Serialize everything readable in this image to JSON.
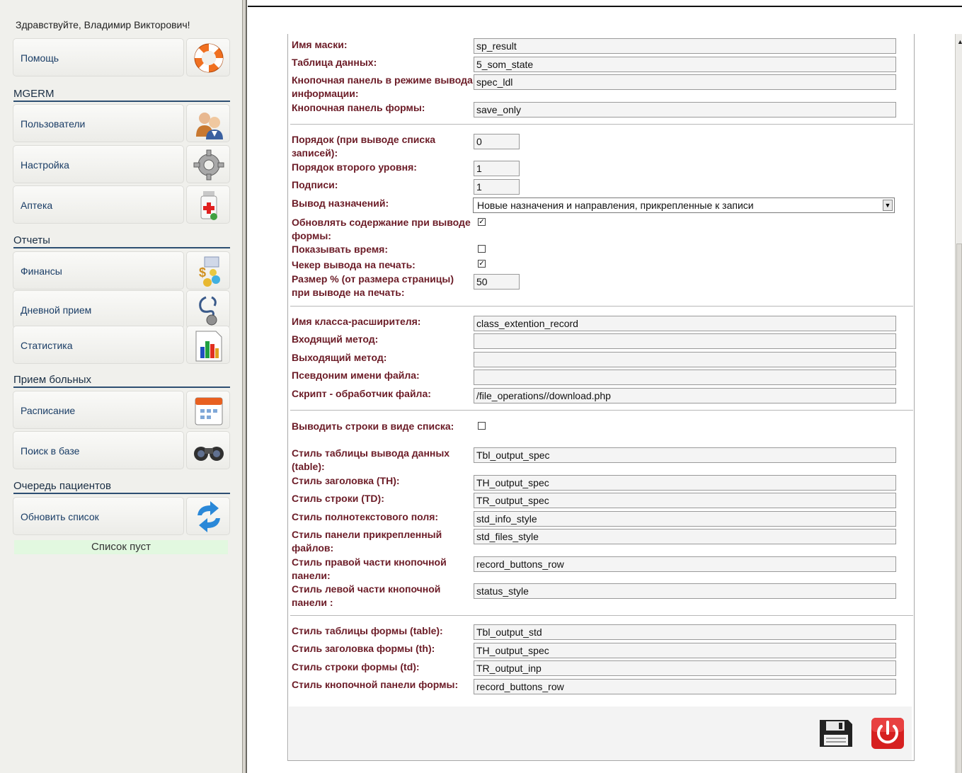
{
  "sidebar": {
    "greeting": "Здравствуйте, Владимир Викторович!",
    "help_label": "Помощь",
    "sections": [
      {
        "title": "MGERM",
        "items": [
          {
            "label": "Пользователи",
            "icon": "users-icon"
          },
          {
            "label": "Настройка",
            "icon": "gear-icon"
          },
          {
            "label": "Аптека",
            "icon": "medicine-bottle-icon"
          }
        ]
      },
      {
        "title": "Отчеты",
        "items": [
          {
            "label": "Финансы",
            "icon": "money-icon"
          },
          {
            "label": "Дневной прием",
            "icon": "stethoscope-icon"
          },
          {
            "label": "Статистика",
            "icon": "bar-chart-icon"
          }
        ]
      },
      {
        "title": "Прием больных",
        "items": [
          {
            "label": "Расписание",
            "icon": "calendar-icon"
          },
          {
            "label": "Поиск в базе",
            "icon": "binoculars-icon"
          }
        ]
      },
      {
        "title": "Очередь пациентов",
        "items": [
          {
            "label": "Обновить список",
            "icon": "refresh-icon"
          }
        ]
      }
    ],
    "queue_status": "Список пуст"
  },
  "form": {
    "mask_name": {
      "label": "Имя маски:",
      "value": "sp_result"
    },
    "data_table": {
      "label": "Таблица данных:",
      "value": "5_som_state"
    },
    "info_button_panel": {
      "label": "Кнопочная панель в режиме вывода информации:",
      "value": "spec_ldl"
    },
    "form_button_panel": {
      "label": "Кнопочная панель формы:",
      "value": "save_only"
    },
    "list_order": {
      "label": "Порядок (при выводе списка записей):",
      "value": "0"
    },
    "second_order": {
      "label": "Порядок второго уровня:",
      "value": "1"
    },
    "captions": {
      "label": "Подписи:",
      "value": "1"
    },
    "assignments_output": {
      "label": "Вывод назначений:",
      "value": "Новые назначения и направления, прикрепленные к записи"
    },
    "refresh_on_output": {
      "label": "Обновлять содержание при выводе формы:",
      "checked": true
    },
    "show_time": {
      "label": "Показывать время:",
      "checked": false
    },
    "print_checker": {
      "label": "Чекер вывода на печать:",
      "checked": true
    },
    "print_size": {
      "label": "Размер % (от размера страницы) при выводе на печать:",
      "value": "50"
    },
    "extender_class": {
      "label": "Имя класса-расширителя:",
      "value": "class_extention_record"
    },
    "input_method": {
      "label": "Входящий метод:",
      "value": ""
    },
    "output_method": {
      "label": "Выходящий метод:",
      "value": ""
    },
    "file_alias": {
      "label": "Псевдоним имени файла:",
      "value": ""
    },
    "file_handler": {
      "label": "Скрипт - обработчик файла:",
      "value": "/file_operations//download.php"
    },
    "rows_as_list": {
      "label": "Выводить строки в виде списка:",
      "checked": false
    },
    "output_table_style": {
      "label": "Стиль таблицы вывода данных (table):",
      "value": "Tbl_output_spec"
    },
    "header_style": {
      "label": "Стиль заголовка (TH):",
      "value": "TH_output_spec"
    },
    "row_style": {
      "label": "Стиль строки (TD):",
      "value": "TR_output_spec"
    },
    "fulltext_style": {
      "label": "Стиль полнотекстового поля:",
      "value": "std_info_style"
    },
    "files_panel_style": {
      "label": "Стиль панели прикрепленный файлов:",
      "value": "std_files_style"
    },
    "right_panel_style": {
      "label": "Стиль правой части кнопочной панели:",
      "value": "record_buttons_row"
    },
    "left_panel_style": {
      "label": "Стиль левой части кнопочной панели :",
      "value": "status_style"
    },
    "form_table_style": {
      "label": "Стиль таблицы формы (table):",
      "value": "Tbl_output_std"
    },
    "form_header_style": {
      "label": "Стиль заголовка формы (th):",
      "value": "TH_output_spec"
    },
    "form_row_style": {
      "label": "Стиль строки формы (td):",
      "value": "TR_output_inp"
    },
    "form_button_panel_style": {
      "label": "Стиль кнопочной панели формы:",
      "value": "record_buttons_row"
    }
  },
  "icons": {
    "save": "floppy-disk-icon",
    "exit": "power-icon"
  },
  "colors": {
    "label": "#6b1b26",
    "nav_text": "#1a3d66",
    "exit_button": "#d62020"
  }
}
